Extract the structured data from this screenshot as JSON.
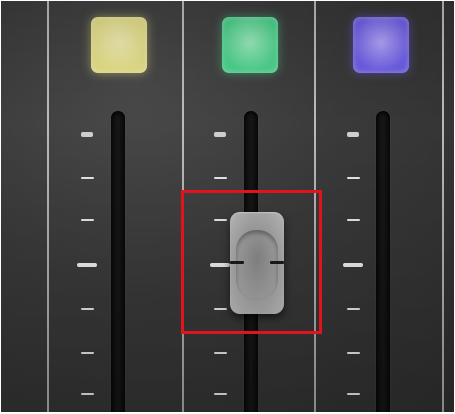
{
  "channels": [
    {
      "pad_color": "#e9e48a",
      "pad_glow": "#f6f2b8"
    },
    {
      "pad_color": "#4ed68f",
      "pad_glow": "#9ff0c2"
    },
    {
      "pad_color": "#7060ea",
      "pad_glow": "#b5a9ff"
    }
  ],
  "highlight": {
    "color": "#e1141b"
  }
}
